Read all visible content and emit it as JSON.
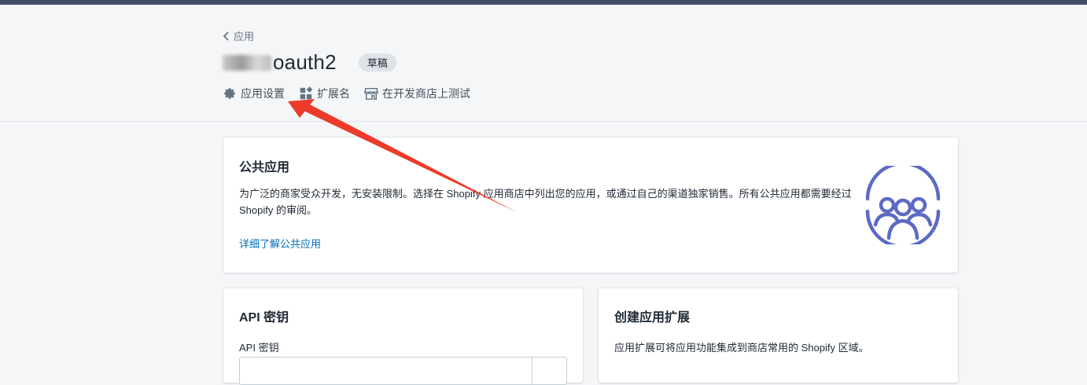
{
  "breadcrumb": {
    "label": "应用"
  },
  "header": {
    "title": "oauth2",
    "badge": "草稿",
    "actions": [
      {
        "label": "应用设置",
        "icon": "gear-icon"
      },
      {
        "label": "扩展名",
        "icon": "extensions-icon"
      },
      {
        "label": "在开发商店上测试",
        "icon": "store-icon"
      }
    ]
  },
  "public_app": {
    "title": "公共应用",
    "description": "为广泛的商家受众开发，无安装限制。选择在 Shopify 应用商店中列出您的应用，或通过自己的渠道独家销售。所有公共应用都需要经过 Shopify 的审阅。",
    "link": "详细了解公共应用",
    "illustration": "people-group-icon"
  },
  "api_keys": {
    "title": "API 密钥",
    "field_label": "API 密钥"
  },
  "extensions": {
    "title": "创建应用扩展",
    "description": "应用扩展可将应用功能集成到商店常用的 Shopify 区域。"
  },
  "colors": {
    "topbar": "#3f4e65",
    "link": "#006fbb",
    "illustration": "#5c6ac4",
    "annotation_arrow": "#ec3b2a"
  }
}
